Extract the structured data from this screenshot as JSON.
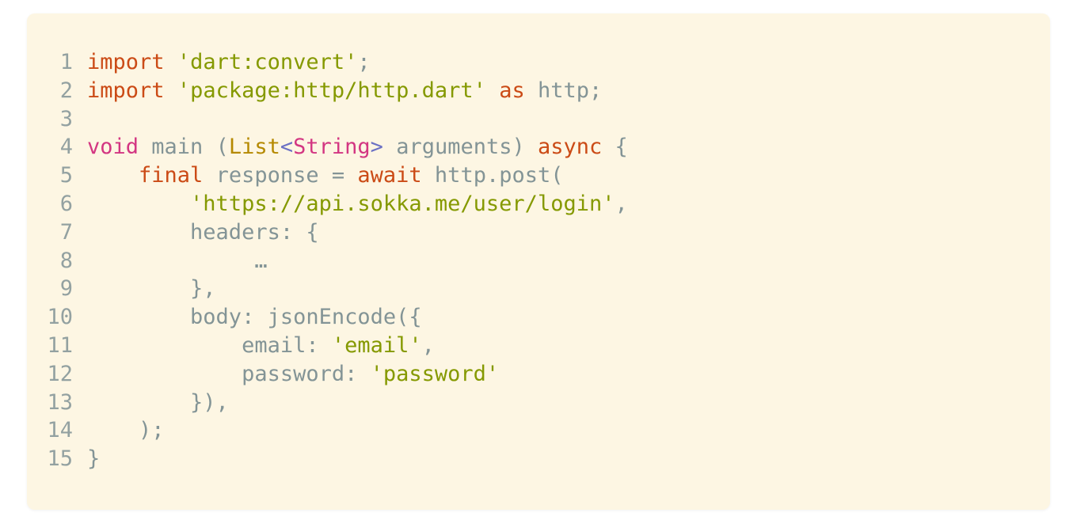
{
  "code_block": {
    "lines": [
      {
        "n": "1",
        "tokens": [
          {
            "t": "import",
            "c": "kw"
          },
          {
            "t": " ",
            "c": "id"
          },
          {
            "t": "'dart:convert'",
            "c": "str"
          },
          {
            "t": ";",
            "c": "id"
          }
        ]
      },
      {
        "n": "2",
        "tokens": [
          {
            "t": "import",
            "c": "kw"
          },
          {
            "t": " ",
            "c": "id"
          },
          {
            "t": "'package:http/http.dart'",
            "c": "str"
          },
          {
            "t": " ",
            "c": "id"
          },
          {
            "t": "as",
            "c": "kw"
          },
          {
            "t": " http;",
            "c": "id"
          }
        ]
      },
      {
        "n": "3",
        "tokens": []
      },
      {
        "n": "4",
        "tokens": [
          {
            "t": "void",
            "c": "kw2"
          },
          {
            "t": " main (",
            "c": "id"
          },
          {
            "t": "List",
            "c": "typ"
          },
          {
            "t": "<",
            "c": "op"
          },
          {
            "t": "String",
            "c": "kw2"
          },
          {
            "t": ">",
            "c": "op"
          },
          {
            "t": " arguments) ",
            "c": "id"
          },
          {
            "t": "async",
            "c": "kw"
          },
          {
            "t": " {",
            "c": "id"
          }
        ]
      },
      {
        "n": "5",
        "tokens": [
          {
            "t": "    ",
            "c": "id"
          },
          {
            "t": "final",
            "c": "kw"
          },
          {
            "t": " response = ",
            "c": "id"
          },
          {
            "t": "await",
            "c": "kw"
          },
          {
            "t": " http.post(",
            "c": "id"
          }
        ]
      },
      {
        "n": "6",
        "tokens": [
          {
            "t": "        ",
            "c": "id"
          },
          {
            "t": "'https://api.sokka.me/user/login'",
            "c": "str"
          },
          {
            "t": ",",
            "c": "id"
          }
        ]
      },
      {
        "n": "7",
        "tokens": [
          {
            "t": "        headers: {",
            "c": "id"
          }
        ]
      },
      {
        "n": "8",
        "tokens": [
          {
            "t": "             …",
            "c": "id"
          }
        ]
      },
      {
        "n": "9",
        "tokens": [
          {
            "t": "        },",
            "c": "id"
          }
        ]
      },
      {
        "n": "10",
        "tokens": [
          {
            "t": "        body: jsonEncode({",
            "c": "id"
          }
        ]
      },
      {
        "n": "11",
        "tokens": [
          {
            "t": "            email: ",
            "c": "id"
          },
          {
            "t": "'email'",
            "c": "str"
          },
          {
            "t": ",",
            "c": "id"
          }
        ]
      },
      {
        "n": "12",
        "tokens": [
          {
            "t": "            password: ",
            "c": "id"
          },
          {
            "t": "'password'",
            "c": "str"
          }
        ]
      },
      {
        "n": "13",
        "tokens": [
          {
            "t": "        }),",
            "c": "id"
          }
        ]
      },
      {
        "n": "14",
        "tokens": [
          {
            "t": "    );",
            "c": "id"
          }
        ]
      },
      {
        "n": "15",
        "tokens": [
          {
            "t": "}",
            "c": "id"
          }
        ]
      }
    ],
    "colors": {
      "background": "#fdf6e3",
      "line_number": "#93a1a1",
      "keyword": "#cb4b16",
      "keyword_alt": "#d33682",
      "string": "#859900",
      "type": "#b58900",
      "operator": "#6c71c4",
      "identifier": "#839496"
    }
  }
}
